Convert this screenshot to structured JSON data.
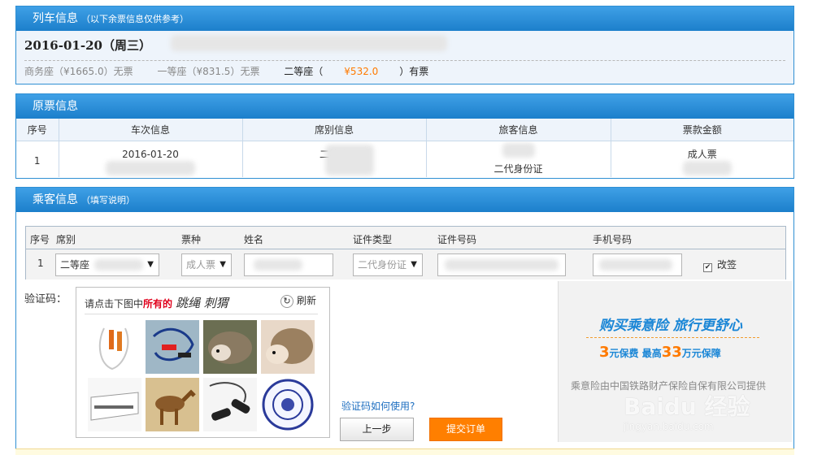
{
  "train_panel": {
    "title": "列车信息",
    "subtitle": "（以下余票信息仅供参考）",
    "date": "2016-01-20（周三）",
    "seats": [
      {
        "text": "商务座（¥1665.0）无票"
      },
      {
        "text": "一等座（¥831.5）无票"
      },
      {
        "label": "二等座（",
        "price": "¥532.0",
        "suffix": "）有票"
      }
    ]
  },
  "orig_panel": {
    "title": "原票信息",
    "columns": [
      "序号",
      "车次信息",
      "席别信息",
      "旅客信息",
      "票款金额"
    ],
    "row": {
      "index": "1",
      "train": "2016-01-20",
      "seat": "二等座",
      "passenger": "二代身份证",
      "amount": "成人票"
    }
  },
  "passenger_panel": {
    "title": "乘客信息",
    "subtitle": "（填写说明）",
    "columns": [
      "序号",
      "席别",
      "票种",
      "姓名",
      "证件类型",
      "证件号码",
      "手机号码"
    ],
    "row": {
      "index": "1",
      "seat": "二等座",
      "ticket_type": "成人票",
      "id_type": "二代身份证",
      "change_label": "改签",
      "change_checked": true
    }
  },
  "captcha": {
    "label": "验证码：",
    "prompt_pre": "请点击下图中",
    "prompt_em": "所有的",
    "words": "跳绳 刺猬",
    "refresh": "刷新",
    "tiles": [
      "jump-rope",
      "jump-rope",
      "hedgehog",
      "hedgehog",
      "heater",
      "camel",
      "jump-rope",
      "plate"
    ]
  },
  "actions": {
    "howto": "验证码如何使用?",
    "prev": "上一步",
    "submit": "提交订单"
  },
  "ad": {
    "headline": "购买乘意险  旅行更舒心",
    "p1": "3",
    "t1": "元保费  最高",
    "p2": "33",
    "t2": "万元保障",
    "footer": "乘意险由中国铁路财产保险自保有限公司提供"
  },
  "watermark": {
    "logo": "Baidu 经验",
    "url": "jingyan.baidu.com"
  }
}
